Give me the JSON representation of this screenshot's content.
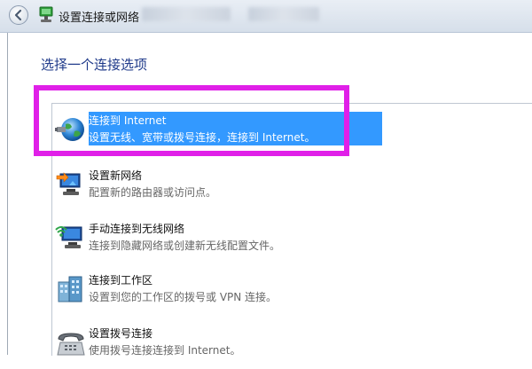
{
  "window": {
    "title": "设置连接或网络",
    "back_icon": "back-arrow-icon",
    "title_icon": "network-setup-icon"
  },
  "heading": "选择一个连接选项",
  "options": [
    {
      "title": "连接到 Internet",
      "description": "设置无线、宽带或拨号连接，连接到 Internet。",
      "icon": "globe-internet-icon",
      "selected": true
    },
    {
      "title": "设置新网络",
      "description": "配置新的路由器或访问点。",
      "icon": "router-network-icon",
      "selected": false
    },
    {
      "title": "手动连接到无线网络",
      "description": "连接到隐藏网络或创建新无线配置文件。",
      "icon": "wireless-network-icon",
      "selected": false
    },
    {
      "title": "连接到工作区",
      "description": "设置到您的工作区的拨号或 VPN 连接。",
      "icon": "workplace-building-icon",
      "selected": false
    },
    {
      "title": "设置拨号连接",
      "description": "使用拨号连接连接到 Internet。",
      "icon": "dialup-telephone-icon",
      "selected": false
    }
  ],
  "colors": {
    "selection": "#3399ff",
    "highlight_annotation": "#e020e8",
    "heading": "#1f3a8a"
  }
}
